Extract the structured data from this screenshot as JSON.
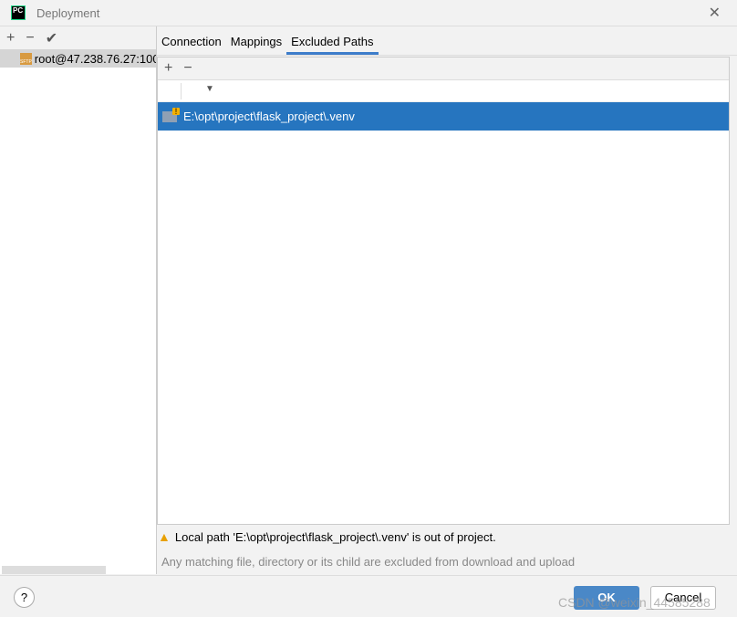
{
  "window": {
    "title": "Deployment",
    "logo": "PC"
  },
  "left": {
    "server": "root@47.238.76.27:100",
    "server_badge": "SFTP"
  },
  "tabs": [
    {
      "label": "Connection"
    },
    {
      "label": "Mappings"
    },
    {
      "label": "Excluded Paths",
      "active": true
    }
  ],
  "excluded": {
    "paths": [
      "E:\\opt\\project\\flask_project\\.venv"
    ]
  },
  "warning": "Local path 'E:\\opt\\project\\flask_project\\.venv' is out of project.",
  "hint": "Any matching file, directory or its child are excluded from download and upload",
  "footer": {
    "help": "?",
    "ok": "OK",
    "cancel": "Cancel"
  },
  "watermark": "CSDN @weixin_44585288"
}
